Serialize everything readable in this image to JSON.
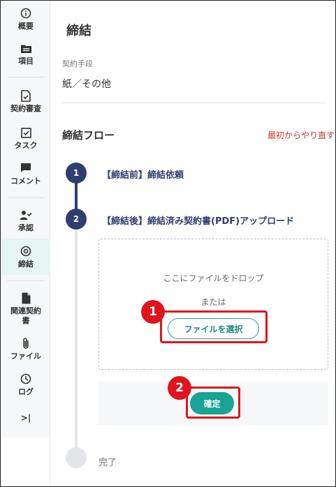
{
  "sidebar": {
    "items": [
      {
        "label": "概要",
        "icon": "info-icon"
      },
      {
        "label": "項目",
        "icon": "folder-icon"
      },
      {
        "label": "契約審査",
        "icon": "document-check-icon"
      },
      {
        "label": "タスク",
        "icon": "checkbox-icon"
      },
      {
        "label": "コメント",
        "icon": "comment-icon"
      },
      {
        "label": "承認",
        "icon": "user-check-icon"
      },
      {
        "label": "締結",
        "icon": "target-icon"
      },
      {
        "label": "関連契約書",
        "label_lines": [
          "関連契約",
          "書"
        ],
        "icon": "document-icon"
      },
      {
        "label": "ファイル",
        "icon": "paperclip-icon"
      },
      {
        "label": "ログ",
        "icon": "clock-icon"
      }
    ],
    "collapse_icon": ">|",
    "active_index": 6,
    "accent_bg": "#e6f4f3"
  },
  "main": {
    "title": "締結",
    "method_label": "契約手段",
    "method_value": "紙／その他",
    "flow_title": "締結フロー",
    "restart_label": "最初からやり直す",
    "steps": [
      {
        "number": "1",
        "label": "【締結前】締結依頼",
        "status": "done"
      },
      {
        "number": "2",
        "label": "【締結後】締結済み契約書(PDF)アップロード",
        "status": "current"
      },
      {
        "number": "",
        "label": "完了",
        "status": "pending"
      }
    ],
    "dropzone": {
      "text": "ここにファイルをドロップ",
      "or": "または",
      "select_button": "ファイルを選択"
    },
    "confirm_button": "確定"
  },
  "annotations": [
    {
      "number": "1"
    },
    {
      "number": "2"
    }
  ],
  "colors": {
    "primary_navy": "#2f3f6e",
    "teal": "#1aa394",
    "danger_red": "#c0392b",
    "annotation_red": "#e0141e"
  }
}
